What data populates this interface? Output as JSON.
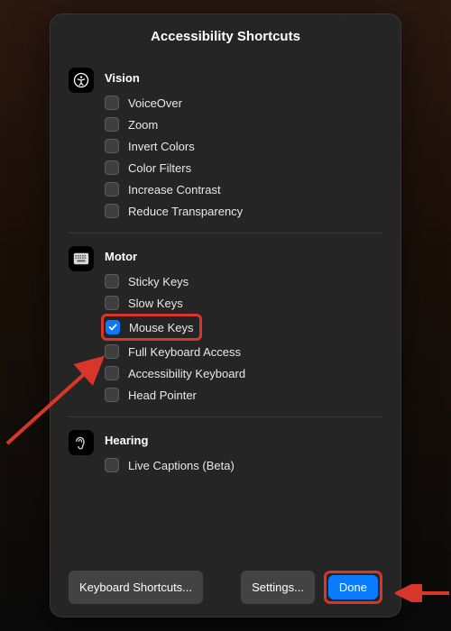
{
  "title": "Accessibility Shortcuts",
  "sections": [
    {
      "icon": "accessibility-icon",
      "title": "Vision",
      "options": [
        {
          "label": "VoiceOver",
          "checked": false
        },
        {
          "label": "Zoom",
          "checked": false
        },
        {
          "label": "Invert Colors",
          "checked": false
        },
        {
          "label": "Color Filters",
          "checked": false
        },
        {
          "label": "Increase Contrast",
          "checked": false
        },
        {
          "label": "Reduce Transparency",
          "checked": false
        }
      ]
    },
    {
      "icon": "keyboard-icon",
      "title": "Motor",
      "options": [
        {
          "label": "Sticky Keys",
          "checked": false
        },
        {
          "label": "Slow Keys",
          "checked": false
        },
        {
          "label": "Mouse Keys",
          "checked": true,
          "highlighted": true
        },
        {
          "label": "Full Keyboard Access",
          "checked": false
        },
        {
          "label": "Accessibility Keyboard",
          "checked": false
        },
        {
          "label": "Head Pointer",
          "checked": false
        }
      ]
    },
    {
      "icon": "ear-icon",
      "title": "Hearing",
      "options": [
        {
          "label": "Live Captions (Beta)",
          "checked": false
        }
      ]
    }
  ],
  "footer": {
    "keyboard_shortcuts": "Keyboard Shortcuts...",
    "settings": "Settings...",
    "done": "Done"
  },
  "colors": {
    "accent": "#0a7aff",
    "highlight": "#d9362a"
  }
}
